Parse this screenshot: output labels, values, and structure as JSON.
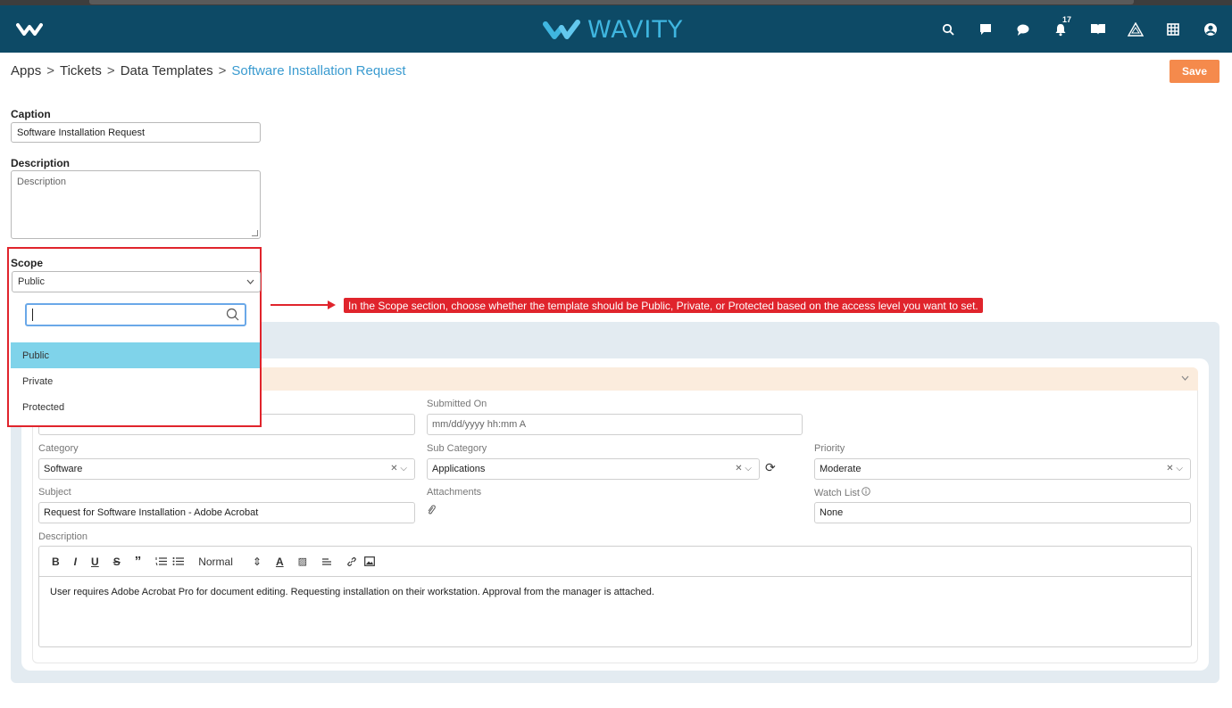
{
  "navbar": {
    "brand": "WAVITY",
    "notification_count": "17",
    "icons": [
      "search-icon",
      "chat-bubble-icon",
      "comment-icon",
      "bell-icon",
      "book-icon",
      "warning-triangle-icon",
      "grid-icon",
      "user-circle-icon"
    ]
  },
  "breadcrumb": {
    "items": [
      "Apps",
      "Tickets",
      "Data Templates"
    ],
    "separator": ">",
    "current": "Software Installation Request"
  },
  "toolbar": {
    "save_label": "Save"
  },
  "form": {
    "caption_label": "Caption",
    "caption_value": "Software Installation Request",
    "description_label": "Description",
    "description_placeholder": "Description",
    "scope_label": "Scope",
    "scope_value": "Public",
    "scope_options": [
      "Public",
      "Private",
      "Protected"
    ],
    "scope_selected": "Public"
  },
  "callout": {
    "text": "In the Scope section, choose whether the template should be Public, Private, or Protected based on the access level you want to set."
  },
  "preview": {
    "submitted_on_label": "Submitted On",
    "submitted_on_placeholder": "mm/dd/yyyy hh:mm A",
    "category_label": "Category",
    "category_value": "Software",
    "sub_category_label": "Sub Category",
    "sub_category_value": "Applications",
    "priority_label": "Priority",
    "priority_value": "Moderate",
    "subject_label": "Subject",
    "subject_value": "Request for Software Installation - Adobe Acrobat",
    "attachments_label": "Attachments",
    "watch_list_label": "Watch List",
    "watch_list_value": "None",
    "description_label": "Description",
    "editor_format": "Normal",
    "editor_text": "User requires Adobe Acrobat Pro for document editing. Requesting installation on their workstation. Approval from the manager is attached."
  },
  "colors": {
    "navbar": "#0d4a66",
    "brand": "#3fb6e0",
    "save": "#f58a4c",
    "highlight": "#e0242c",
    "selected_option": "#7fd3ea",
    "link": "#3a9bd0"
  }
}
